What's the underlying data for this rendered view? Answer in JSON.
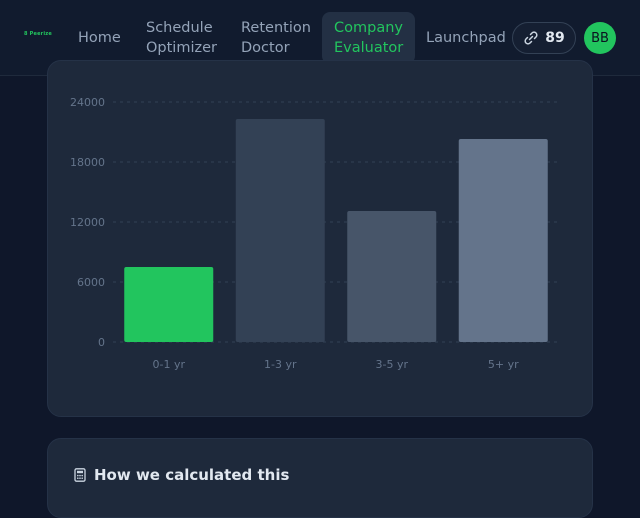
{
  "header": {
    "logo_text": "8 Peerize",
    "nav": [
      {
        "label_line1": "Home",
        "label_line2": ""
      },
      {
        "label_line1": "Schedule",
        "label_line2": "Optimizer"
      },
      {
        "label_line1": "Retention",
        "label_line2": "Doctor"
      },
      {
        "label_line1": "Company",
        "label_line2": "Evaluator"
      },
      {
        "label_line1": "Launchpad",
        "label_line2": ""
      }
    ],
    "active_nav": "Company Evaluator",
    "streak_count": "89",
    "streak_icon": "link-icon",
    "avatar_initials": "BB"
  },
  "colors": {
    "accent": "#22c55e",
    "bar_1_3": "#334155",
    "bar_3_5": "#475569",
    "bar_5plus": "#64748b"
  },
  "chart_data": {
    "type": "bar",
    "categories": [
      "0-1 yr",
      "1-3 yr",
      "3-5 yr",
      "5+ yr"
    ],
    "values": [
      7500,
      22300,
      13100,
      20300
    ],
    "yticks": [
      "0",
      "6000",
      "12000",
      "18000",
      "24000"
    ],
    "ylim": [
      0,
      24000
    ],
    "grid": true,
    "title": "",
    "xlabel": "",
    "ylabel": ""
  },
  "calc_card": {
    "title": "How we calculated this",
    "icon": "calculator-icon"
  }
}
